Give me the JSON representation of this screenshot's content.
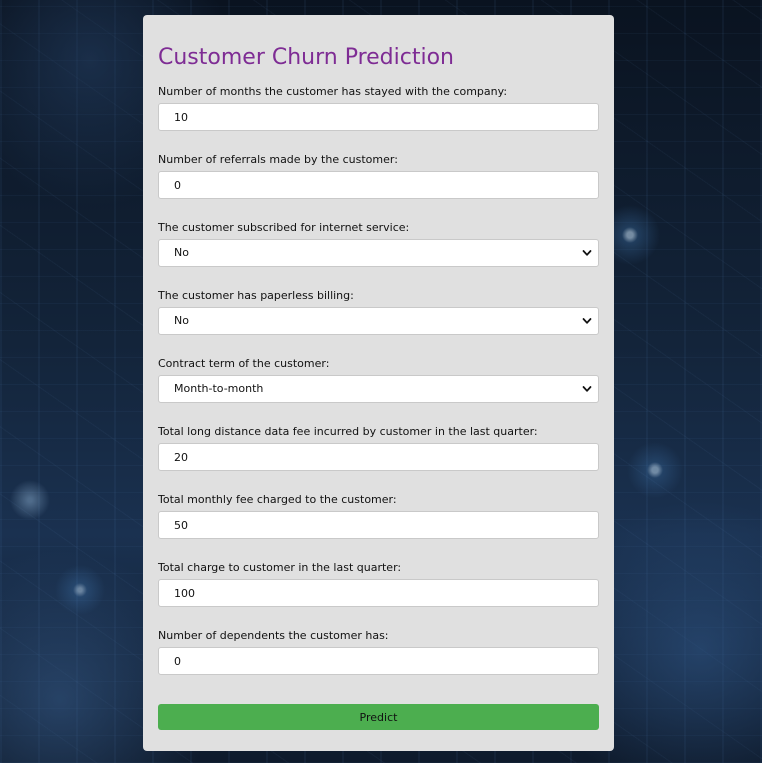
{
  "title": "Customer Churn Prediction",
  "fields": [
    {
      "label": "Number of months the customer has stayed with the company:",
      "value": "10",
      "type": "input"
    },
    {
      "label": "Number of referrals made by the customer:",
      "value": "0",
      "type": "input"
    },
    {
      "label": "The customer subscribed for internet service:",
      "value": "No",
      "type": "select"
    },
    {
      "label": "The customer has paperless billing:",
      "value": "No",
      "type": "select"
    },
    {
      "label": "Contract term of the customer:",
      "value": "Month-to-month",
      "type": "select"
    },
    {
      "label": "Total long distance data fee incurred by customer in the last quarter:",
      "value": "20",
      "type": "input"
    },
    {
      "label": "Total monthly fee charged to the customer:",
      "value": "50",
      "type": "input"
    },
    {
      "label": "Total charge to customer in the last quarter:",
      "value": "100",
      "type": "input"
    },
    {
      "label": "Number of dependents the customer has:",
      "value": "0",
      "type": "input"
    }
  ],
  "submit_label": "Predict",
  "colors": {
    "title": "#7e2c94",
    "card": "#e0e0e0",
    "button": "#4cae4f"
  },
  "icons": {
    "select_arrow": "chevron-down-icon"
  }
}
